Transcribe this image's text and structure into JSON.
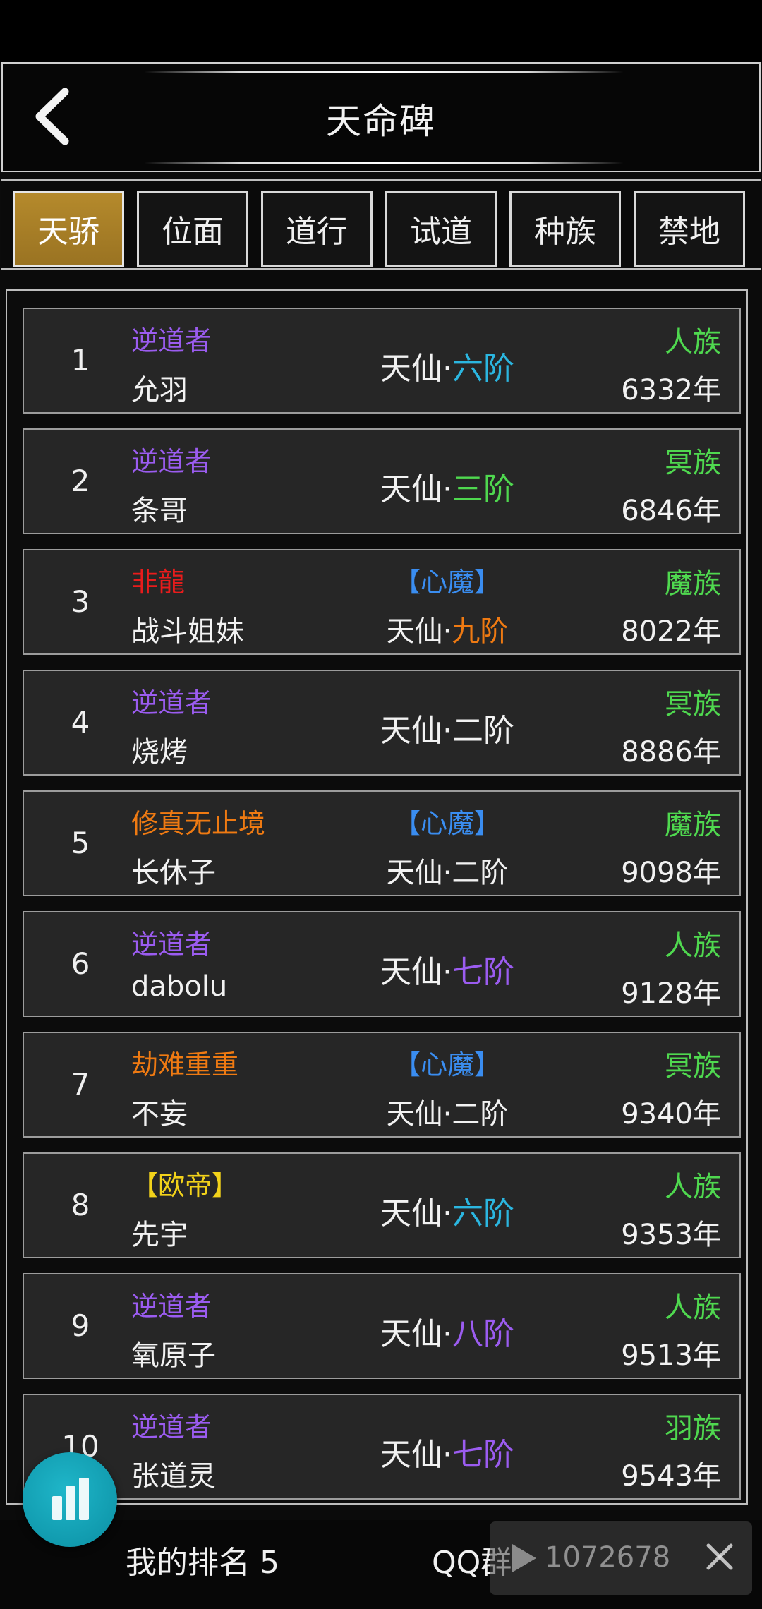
{
  "header": {
    "title": "天命碑"
  },
  "tabs": [
    {
      "label": "天骄",
      "active": true
    },
    {
      "label": "位面",
      "active": false
    },
    {
      "label": "道行",
      "active": false
    },
    {
      "label": "试道",
      "active": false
    },
    {
      "label": "种族",
      "active": false
    },
    {
      "label": "禁地",
      "active": false
    }
  ],
  "rows": [
    {
      "rank": "1",
      "title": "逆道者",
      "title_color": "#9b5cf0",
      "name": "允羽",
      "status": "",
      "realm_base": "天仙·",
      "realm_stage": "六阶",
      "stage_color": "#2bb6e0",
      "race": "人族",
      "years": "6332年"
    },
    {
      "rank": "2",
      "title": "逆道者",
      "title_color": "#9b5cf0",
      "name": "条哥",
      "status": "",
      "realm_base": "天仙·",
      "realm_stage": "三阶",
      "stage_color": "#4fd84f",
      "race": "冥族",
      "years": "6846年"
    },
    {
      "rank": "3",
      "title": "非龍",
      "title_color": "#e81c1c",
      "name": "战斗姐妹",
      "status": "【心魔】",
      "realm_base": "天仙·",
      "realm_stage": "九阶",
      "stage_color": "#ef7a12",
      "race": "魔族",
      "years": "8022年"
    },
    {
      "rank": "4",
      "title": "逆道者",
      "title_color": "#9b5cf0",
      "name": "烧烤",
      "status": "",
      "realm_base": "天仙·",
      "realm_stage": "二阶",
      "stage_color": "#f2f2f2",
      "race": "冥族",
      "years": "8886年"
    },
    {
      "rank": "5",
      "title": "修真无止境",
      "title_color": "#ef7a12",
      "name": "长休子",
      "status": "【心魔】",
      "realm_base": "天仙·",
      "realm_stage": "二阶",
      "stage_color": "#f2f2f2",
      "race": "魔族",
      "years": "9098年"
    },
    {
      "rank": "6",
      "title": "逆道者",
      "title_color": "#9b5cf0",
      "name": "dabolu",
      "status": "",
      "realm_base": "天仙·",
      "realm_stage": "七阶",
      "stage_color": "#9b5cf0",
      "race": "人族",
      "years": "9128年"
    },
    {
      "rank": "7",
      "title": "劫难重重",
      "title_color": "#ef7a12",
      "name": "不妄",
      "status": "【心魔】",
      "realm_base": "天仙·",
      "realm_stage": "二阶",
      "stage_color": "#f2f2f2",
      "race": "冥族",
      "years": "9340年"
    },
    {
      "rank": "8",
      "title": "【欧帝】",
      "title_color": "#f2d21a",
      "name": "先宇",
      "status": "",
      "realm_base": "天仙·",
      "realm_stage": "六阶",
      "stage_color": "#2bb6e0",
      "race": "人族",
      "years": "9353年"
    },
    {
      "rank": "9",
      "title": "逆道者",
      "title_color": "#9b5cf0",
      "name": "氧原子",
      "status": "",
      "realm_base": "天仙·",
      "realm_stage": "八阶",
      "stage_color": "#9b5cf0",
      "race": "人族",
      "years": "9513年"
    },
    {
      "rank": "10",
      "title": "逆道者",
      "title_color": "#9b5cf0",
      "name": "张道灵",
      "status": "",
      "realm_base": "天仙·",
      "realm_stage": "七阶",
      "stage_color": "#9b5cf0",
      "race": "羽族",
      "years": "9543年"
    }
  ],
  "footer": {
    "my_rank": "我的排名 5",
    "qq": "QQ群"
  },
  "ad": {
    "text": "1072678"
  },
  "icons": {
    "back": "chevron-left-icon",
    "fab": "bar-chart-icon",
    "play": "play-icon",
    "close": "close-icon"
  },
  "colors": {
    "active_tab": "#b58a2c",
    "race": "#4fd84f",
    "fab": "#1fb6c9"
  }
}
